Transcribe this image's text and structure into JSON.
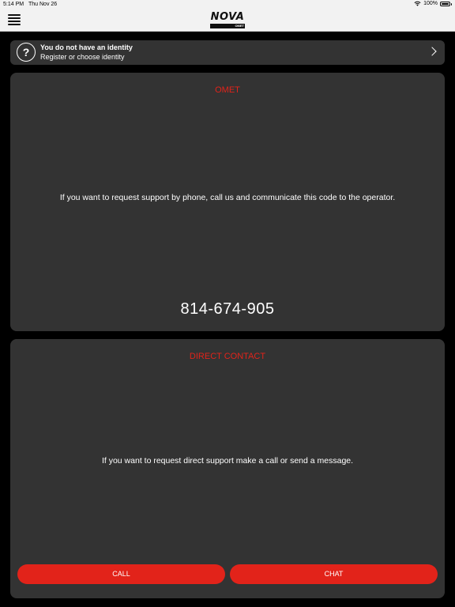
{
  "status_bar": {
    "time": "5:14 PM",
    "date": "Thu Nov 26",
    "battery": "100%"
  },
  "nav": {
    "menu_icon": "hamburger-icon",
    "logo_text": "NOVA",
    "logo_sub": "OMET"
  },
  "identity": {
    "icon": "question-icon",
    "icon_glyph": "?",
    "title": "You do not have an identity",
    "subtitle": "Register or choose identity",
    "chevron_icon": "chevron-right-icon"
  },
  "omet_card": {
    "title": "OMET",
    "message": "If you want to request support by phone, call us and communicate this code to the operator.",
    "code": "814-674-905"
  },
  "direct_card": {
    "title": "DIRECT CONTACT",
    "message": "If you want to request direct support make a call or send a message.",
    "call_label": "CALL",
    "chat_label": "CHAT"
  },
  "colors": {
    "accent": "#e2231a",
    "card_bg": "#333333",
    "page_bg": "#000000",
    "bar_bg": "#f2f2f2"
  }
}
